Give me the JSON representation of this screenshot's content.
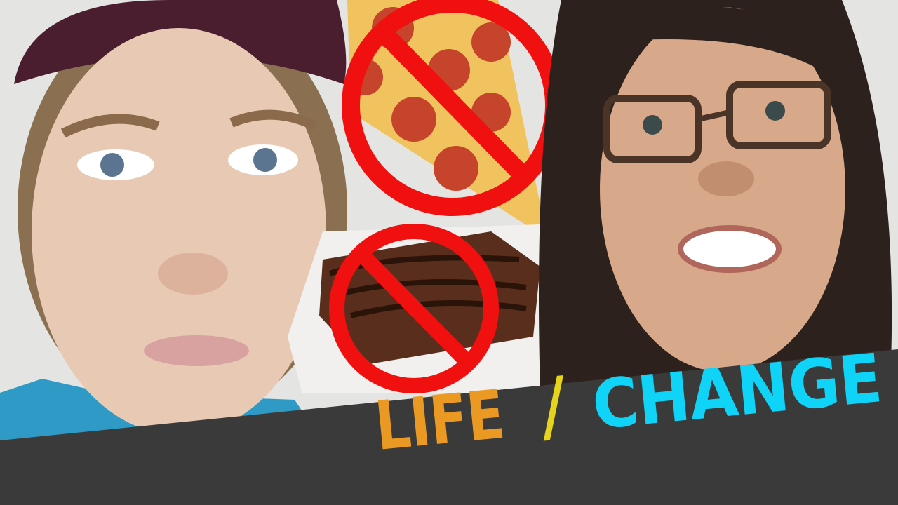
{
  "title": {
    "part1": "LIFE",
    "separator": "/",
    "part2": "CHANGE"
  },
  "colors": {
    "part1": "#ea9a22",
    "separator": "#e6d31a",
    "part2": "#0fd3f7",
    "band": "#3a3a3a",
    "prohibition": "#f01010"
  }
}
